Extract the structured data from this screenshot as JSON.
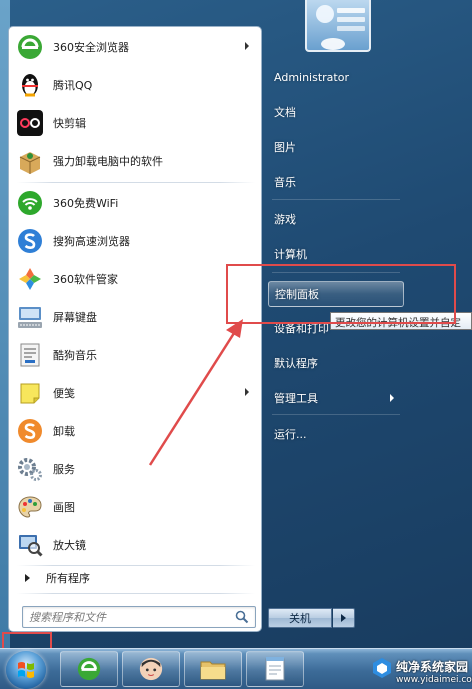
{
  "left_pane": {
    "pinned": [
      {
        "label": "360安全浏览器",
        "icon": "360-browser-icon",
        "has_submenu": true
      },
      {
        "label": "腾讯QQ",
        "icon": "qq-penguin-icon",
        "has_submenu": false
      },
      {
        "label": "快剪辑",
        "icon": "video-editor-icon",
        "has_submenu": false
      },
      {
        "label": "强力卸载电脑中的软件",
        "icon": "uninstaller-box-icon",
        "has_submenu": false
      }
    ],
    "recent": [
      {
        "label": "360免费WiFi",
        "icon": "wifi-icon",
        "has_submenu": false
      },
      {
        "label": "搜狗高速浏览器",
        "icon": "sogou-browser-icon",
        "has_submenu": false
      },
      {
        "label": "360软件管家",
        "icon": "software-manager-icon",
        "has_submenu": false
      },
      {
        "label": "屏幕键盘",
        "icon": "keyboard-icon",
        "has_submenu": false
      },
      {
        "label": "酷狗音乐",
        "icon": "kugou-music-icon",
        "has_submenu": false
      },
      {
        "label": "便笺",
        "icon": "sticky-note-icon",
        "has_submenu": true
      },
      {
        "label": "卸载",
        "icon": "uninstall-icon",
        "has_submenu": false
      },
      {
        "label": "服务",
        "icon": "services-gear-icon",
        "has_submenu": false
      },
      {
        "label": "画图",
        "icon": "paint-palette-icon",
        "has_submenu": false
      },
      {
        "label": "放大镜",
        "icon": "magnifier-icon",
        "has_submenu": false
      }
    ],
    "all_programs": "所有程序",
    "search_placeholder": "搜索程序和文件"
  },
  "right_pane": {
    "user": "Administrator",
    "items": [
      {
        "label": "文档",
        "has_submenu": false
      },
      {
        "label": "图片",
        "has_submenu": false
      },
      {
        "label": "音乐",
        "has_submenu": false
      },
      {
        "label": "游戏",
        "has_submenu": false
      },
      {
        "label": "计算机",
        "has_submenu": false
      },
      {
        "label": "控制面板",
        "has_submenu": false,
        "highlighted": true
      },
      {
        "label": "设备和打印",
        "has_submenu": false
      },
      {
        "label": "默认程序",
        "has_submenu": false
      },
      {
        "label": "管理工具",
        "has_submenu": true
      },
      {
        "label": "运行...",
        "has_submenu": false
      }
    ],
    "tooltip": "更改您的计算机设置并自定",
    "shutdown_label": "关机"
  },
  "taskbar": {
    "buttons": [
      "360-browser-icon",
      "user-avatar-icon",
      "file-explorer-icon",
      "notepad-icon"
    ]
  },
  "watermark": {
    "title": "纯净系统家园",
    "url": "www.yidaimei.com"
  },
  "colors": {
    "annotation_red": "#e04b4b",
    "menu_blue": "#1f4a72"
  }
}
